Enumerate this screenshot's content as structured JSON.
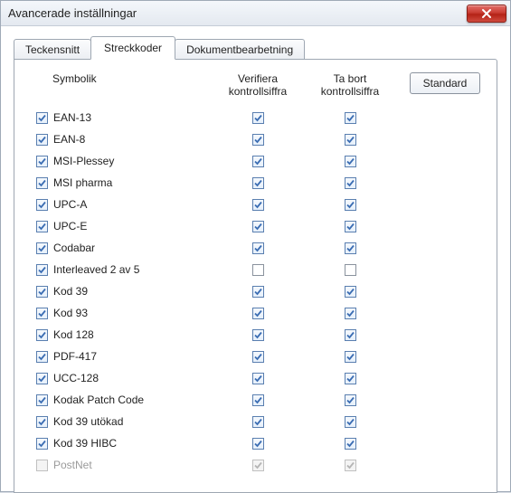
{
  "window_title": "Avancerade inställningar",
  "tabs": {
    "fonts": "Teckensnitt",
    "barcodes": "Streckkoder",
    "docproc": "Dokumentbearbetning"
  },
  "active_tab": "barcodes",
  "buttons": {
    "standard": "Standard"
  },
  "columns": {
    "symbology": "Symbolik",
    "verify_line1": "Verifiera",
    "verify_line2": "kontrollsiffra",
    "remove_line1": "Ta bort",
    "remove_line2": "kontrollsiffra"
  },
  "rows": [
    {
      "id": "ean13",
      "label": "EAN-13",
      "sym": true,
      "verify": true,
      "remove": true,
      "disabled": false
    },
    {
      "id": "ean8",
      "label": "EAN-8",
      "sym": true,
      "verify": true,
      "remove": true,
      "disabled": false
    },
    {
      "id": "msiplessey",
      "label": "MSI-Plessey",
      "sym": true,
      "verify": true,
      "remove": true,
      "disabled": false
    },
    {
      "id": "msipharma",
      "label": "MSI pharma",
      "sym": true,
      "verify": true,
      "remove": true,
      "disabled": false
    },
    {
      "id": "upca",
      "label": "UPC-A",
      "sym": true,
      "verify": true,
      "remove": true,
      "disabled": false
    },
    {
      "id": "upce",
      "label": "UPC-E",
      "sym": true,
      "verify": true,
      "remove": true,
      "disabled": false
    },
    {
      "id": "codabar",
      "label": "Codabar",
      "sym": true,
      "verify": true,
      "remove": true,
      "disabled": false
    },
    {
      "id": "i2of5",
      "label": "Interleaved 2 av 5",
      "sym": true,
      "verify": false,
      "remove": false,
      "disabled": false
    },
    {
      "id": "code39",
      "label": "Kod 39",
      "sym": true,
      "verify": true,
      "remove": true,
      "disabled": false
    },
    {
      "id": "code93",
      "label": "Kod 93",
      "sym": true,
      "verify": true,
      "remove": true,
      "disabled": false
    },
    {
      "id": "code128",
      "label": "Kod 128",
      "sym": true,
      "verify": true,
      "remove": true,
      "disabled": false
    },
    {
      "id": "pdf417",
      "label": "PDF-417",
      "sym": true,
      "verify": true,
      "remove": true,
      "disabled": false
    },
    {
      "id": "ucc128",
      "label": "UCC-128",
      "sym": true,
      "verify": true,
      "remove": true,
      "disabled": false
    },
    {
      "id": "kodakpatch",
      "label": "Kodak Patch Code",
      "sym": true,
      "verify": true,
      "remove": true,
      "disabled": false
    },
    {
      "id": "code39ext",
      "label": "Kod 39 utökad",
      "sym": true,
      "verify": true,
      "remove": true,
      "disabled": false
    },
    {
      "id": "code39hibc",
      "label": "Kod 39 HIBC",
      "sym": true,
      "verify": true,
      "remove": true,
      "disabled": false
    },
    {
      "id": "postnet",
      "label": "PostNet",
      "sym": false,
      "verify": true,
      "remove": true,
      "disabled": true
    }
  ]
}
